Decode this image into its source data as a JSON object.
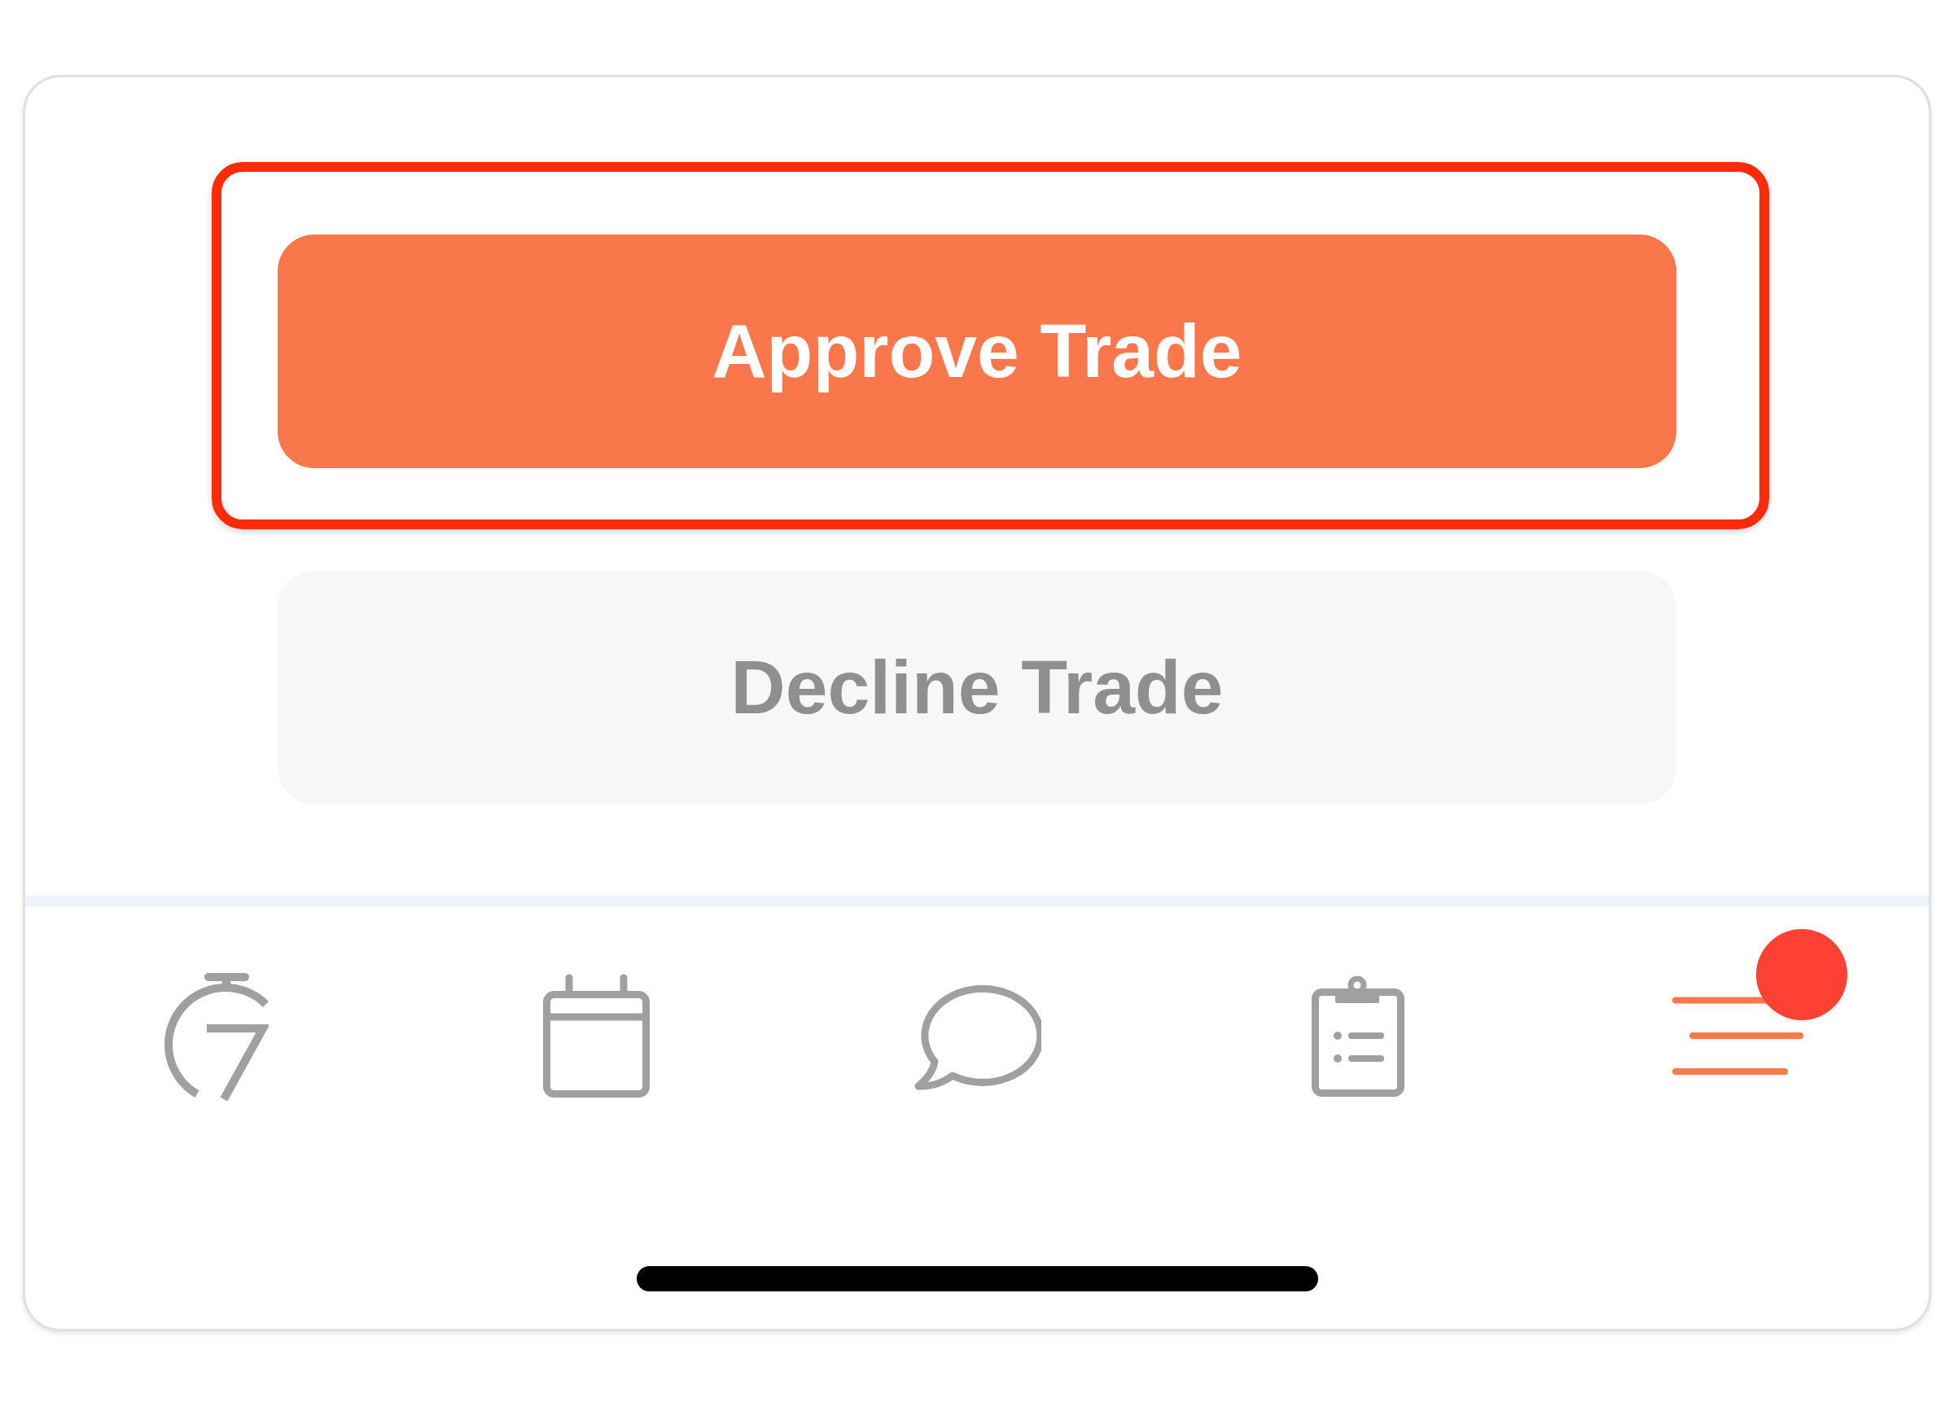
{
  "actions": [
    {
      "label": "Approve Trade",
      "kind": "primary",
      "highlighted": true
    },
    {
      "label": "Decline Trade",
      "kind": "secondary",
      "highlighted": false
    }
  ],
  "tab_bar": {
    "tabs": [
      {
        "kind": "timer",
        "selected": false,
        "badge": false
      },
      {
        "kind": "calendar",
        "selected": false,
        "badge": false
      },
      {
        "kind": "chat",
        "selected": false,
        "badge": false
      },
      {
        "kind": "clipboard",
        "selected": false,
        "badge": false
      },
      {
        "kind": "menu",
        "selected": true,
        "badge": true
      }
    ]
  }
}
